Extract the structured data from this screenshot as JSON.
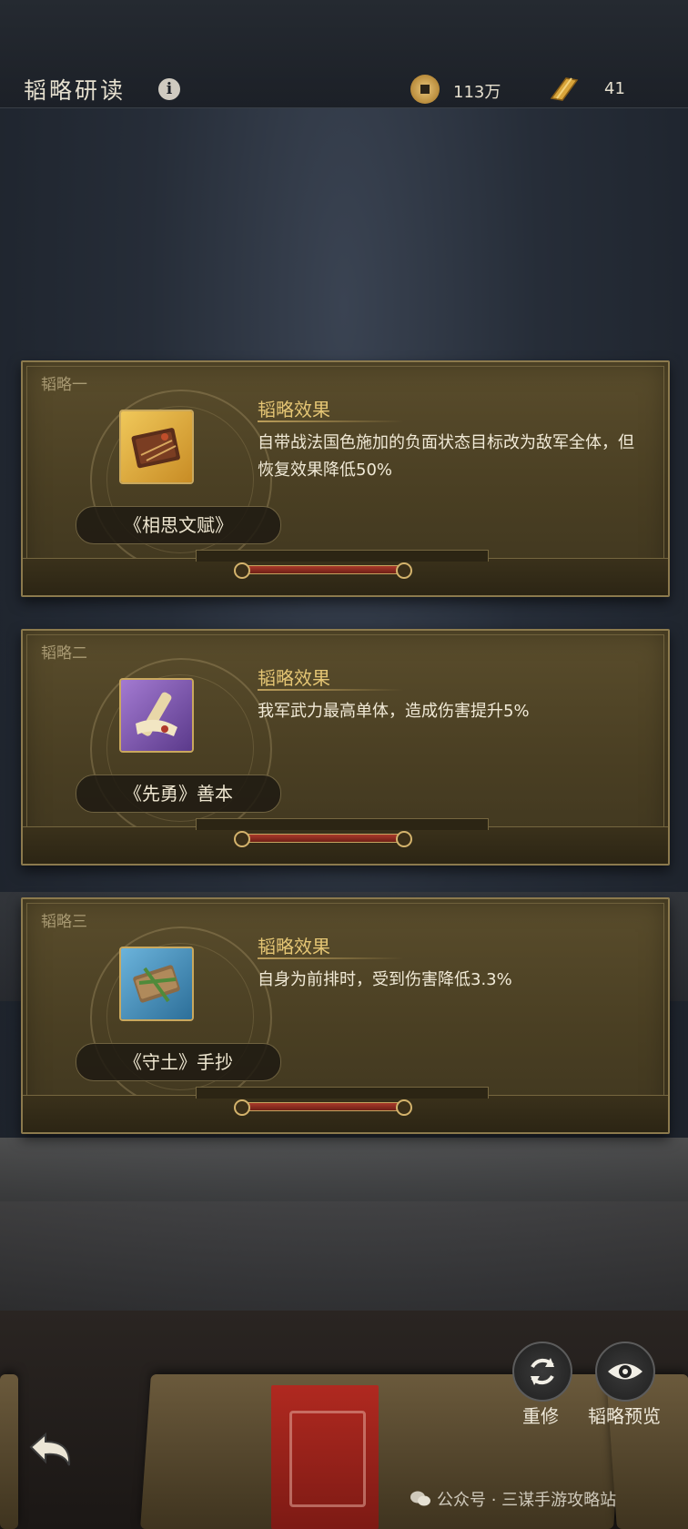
{
  "header": {
    "title": "韬略研读",
    "info_icon": "info-icon",
    "coins": {
      "icon": "coin-icon",
      "value": "113万"
    },
    "scrolls": {
      "icon": "scroll-icon",
      "value": "41"
    }
  },
  "cards": [
    {
      "label": "韬略一",
      "item_icon": "gift-book-icon",
      "frame_color": "#e0b144",
      "book_name": "《相思文赋》",
      "effect_title": "韬略效果",
      "effect_text": "自带战法国色施加的负面状态目标改为敌军全体，但恢复效果降低50%"
    },
    {
      "label": "韬略二",
      "item_icon": "scroll-icon",
      "frame_color": "#8b62bb",
      "book_name": "《先勇》善本",
      "effect_title": "韬略效果",
      "effect_text": "我军武力最高单体，造成伤害提升5%"
    },
    {
      "label": "韬略三",
      "item_icon": "tied-book-icon",
      "frame_color": "#4c97c4",
      "book_name": "《守土》手抄",
      "effect_title": "韬略效果",
      "effect_text": "自身为前排时，受到伤害降低3.3%"
    }
  ],
  "buttons": {
    "rebuild": {
      "label": "重修",
      "icon": "refresh-icon"
    },
    "preview": {
      "label": "韬略预览",
      "icon": "eye-icon"
    },
    "back": {
      "icon": "back-arrow-icon"
    }
  },
  "watermark": "公众号 · 三谋手游攻略站",
  "colors": {
    "effect_title": "#e4c574",
    "card_bg": "#4a3f23",
    "slider": "#a9392a"
  }
}
